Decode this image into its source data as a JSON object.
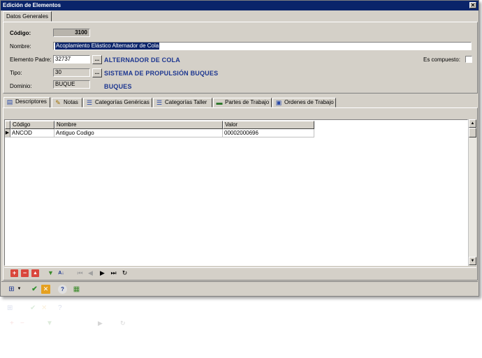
{
  "window": {
    "title": "Edición de Elementos",
    "close_symbol": "✕"
  },
  "top_tab": {
    "label": "Datos Generales"
  },
  "form": {
    "codigo_label": "Código:",
    "codigo_value": "3100",
    "nombre_label": "Nombre:",
    "nombre_value": "Acoplamiento Elástico Alternador de Cola",
    "padre_label": "Elemento Padre:",
    "padre_value": "32737",
    "padre_desc": "ALTERNADOR DE COLA",
    "tipo_label": "Tipo:",
    "tipo_value": "30",
    "tipo_desc": "SISTEMA DE PROPULSIÓN BUQUES",
    "dominio_label": "Dominio:",
    "dominio_value": "BUQUE",
    "dominio_desc": "BUQUES",
    "compuesto_label": "Es compuesto:",
    "ellipsis": "..."
  },
  "tabs": [
    {
      "label": "Descriptores"
    },
    {
      "label": "Notas"
    },
    {
      "label": "Categorías Genéricas"
    },
    {
      "label": "Categorías Taller"
    },
    {
      "label": "Partes de Trabajo"
    },
    {
      "label": "Ordenes de Trabajo"
    }
  ],
  "grid": {
    "columns": [
      "Código",
      "Nombre",
      "Valor"
    ],
    "rows": [
      {
        "codigo": "ANCOD",
        "nombre": "Antiguo Codigo",
        "valor": "00002000696"
      }
    ],
    "row_indicator": "▶"
  },
  "icons": {
    "descriptores": "table-icon",
    "notas": "notes-icon",
    "cat_genericas": "list-icon",
    "cat_taller": "list-icon",
    "partes": "report-icon",
    "ordenes": "document-icon"
  },
  "colors": {
    "title_bar": "#0a246a",
    "accent_blue": "#1c3690",
    "face": "#d4d0c8"
  }
}
